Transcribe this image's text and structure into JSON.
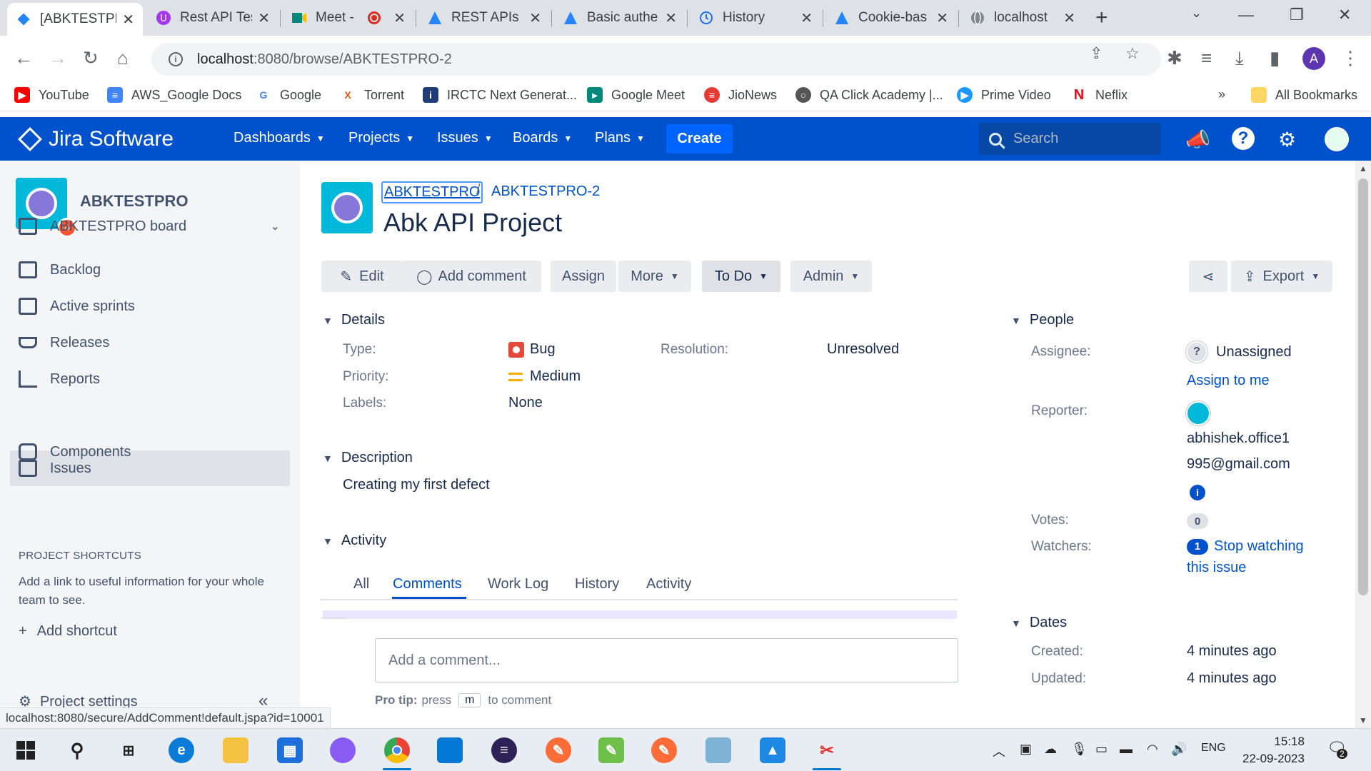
{
  "browser": {
    "tabs": [
      {
        "title": "[ABKTESTPRO",
        "icon": "jira-icon",
        "active": true
      },
      {
        "title": "Rest API Tes",
        "icon": "course-icon"
      },
      {
        "title": "Meet -",
        "icon": "google-meet-icon"
      },
      {
        "title": "REST APIs",
        "icon": "atlassian-icon"
      },
      {
        "title": "Basic authe",
        "icon": "atlassian-icon"
      },
      {
        "title": "History",
        "icon": "history-icon"
      },
      {
        "title": "Cookie-bas",
        "icon": "atlassian-icon"
      },
      {
        "title": "localhost",
        "icon": "globe-icon"
      }
    ],
    "url_host": "localhost",
    "url_path": ":8080/browse/ABKTESTPRO-2",
    "profile_initial": "A",
    "bookmarks": [
      {
        "label": "YouTube",
        "icon": "youtube-icon",
        "color": "#ff0000"
      },
      {
        "label": "AWS_Google Docs",
        "icon": "docs-icon",
        "color": "#4285f4"
      },
      {
        "label": "Google",
        "icon": "google-icon",
        "color": "#4285f4"
      },
      {
        "label": "Torrent",
        "icon": "torrent-icon",
        "color": "#e8570c"
      },
      {
        "label": "IRCTC Next Generat...",
        "icon": "irctc-icon",
        "color": "#213d77"
      },
      {
        "label": "Google Meet",
        "icon": "google-meet-icon",
        "color": "#00897b"
      },
      {
        "label": "JioNews",
        "icon": "jionews-icon",
        "color": "#e53935"
      },
      {
        "label": "QA Click Academy |...",
        "icon": "globe-icon",
        "color": "#555555"
      },
      {
        "label": "Prime Video",
        "icon": "prime-icon",
        "color": "#1a98ff"
      },
      {
        "label": "Neflix",
        "icon": "netflix-icon",
        "color": "#e50914"
      }
    ],
    "more_bookmarks": "»",
    "all_bookmarks": "All Bookmarks",
    "status_url": "localhost:8080/secure/AddComment!default.jspa?id=10001"
  },
  "jira": {
    "logo": "Jira Software",
    "nav": [
      "Dashboards",
      "Projects",
      "Issues",
      "Boards",
      "Plans"
    ],
    "create": "Create",
    "search_placeholder": "Search",
    "accent": "#0052cc"
  },
  "sidebar": {
    "project_name": "ABKTESTPRO",
    "board": "ABKTESTPRO board",
    "items": [
      "Backlog",
      "Active sprints",
      "Releases",
      "Reports",
      "Issues",
      "Components"
    ],
    "selected": "Issues",
    "shortcuts_title": "PROJECT SHORTCUTS",
    "shortcuts_text": "Add a link to useful information for your whole team to see.",
    "add_shortcut": "Add shortcut",
    "project_settings": "Project settings"
  },
  "issue": {
    "breadcrumb_project": "ABKTESTPRO",
    "breadcrumb_sep": "/",
    "breadcrumb_key": "ABKTESTPRO-2",
    "title": "Abk API Project",
    "buttons": {
      "edit": "Edit",
      "add_comment": "Add comment",
      "assign": "Assign",
      "more": "More",
      "status": "To Do",
      "admin": "Admin",
      "export": "Export"
    },
    "details_title": "Details",
    "type_label": "Type:",
    "type_value": "Bug",
    "priority_label": "Priority:",
    "priority_value": "Medium",
    "labels_label": "Labels:",
    "labels_value": "None",
    "resolution_label": "Resolution:",
    "resolution_value": "Unresolved",
    "description_title": "Description",
    "description_text": "Creating my first defect",
    "activity_title": "Activity",
    "activity_tabs": [
      "All",
      "Comments",
      "Work Log",
      "History",
      "Activity"
    ],
    "active_tab": "Comments",
    "comment_placeholder": "Add a comment...",
    "protip_label": "Pro tip:",
    "protip_press": "press",
    "protip_key": "m",
    "protip_suffix": "to comment"
  },
  "people": {
    "title": "People",
    "assignee_label": "Assignee:",
    "assignee_value": "Unassigned",
    "assign_to_me": "Assign to me",
    "reporter_label": "Reporter:",
    "reporter_line1": "abhishek.office1",
    "reporter_line2": "995@gmail.com",
    "votes_label": "Votes:",
    "votes_value": "0",
    "watchers_label": "Watchers:",
    "watchers_value": "1",
    "watch_link_1": "Stop watching",
    "watch_link_2": "this issue"
  },
  "dates": {
    "title": "Dates",
    "created_label": "Created:",
    "created_value": "4 minutes ago",
    "updated_label": "Updated:",
    "updated_value": "4 minutes ago"
  },
  "taskbar": {
    "lang": "ENG",
    "time": "15:18",
    "date": "22-09-2023",
    "notifications": "2"
  }
}
